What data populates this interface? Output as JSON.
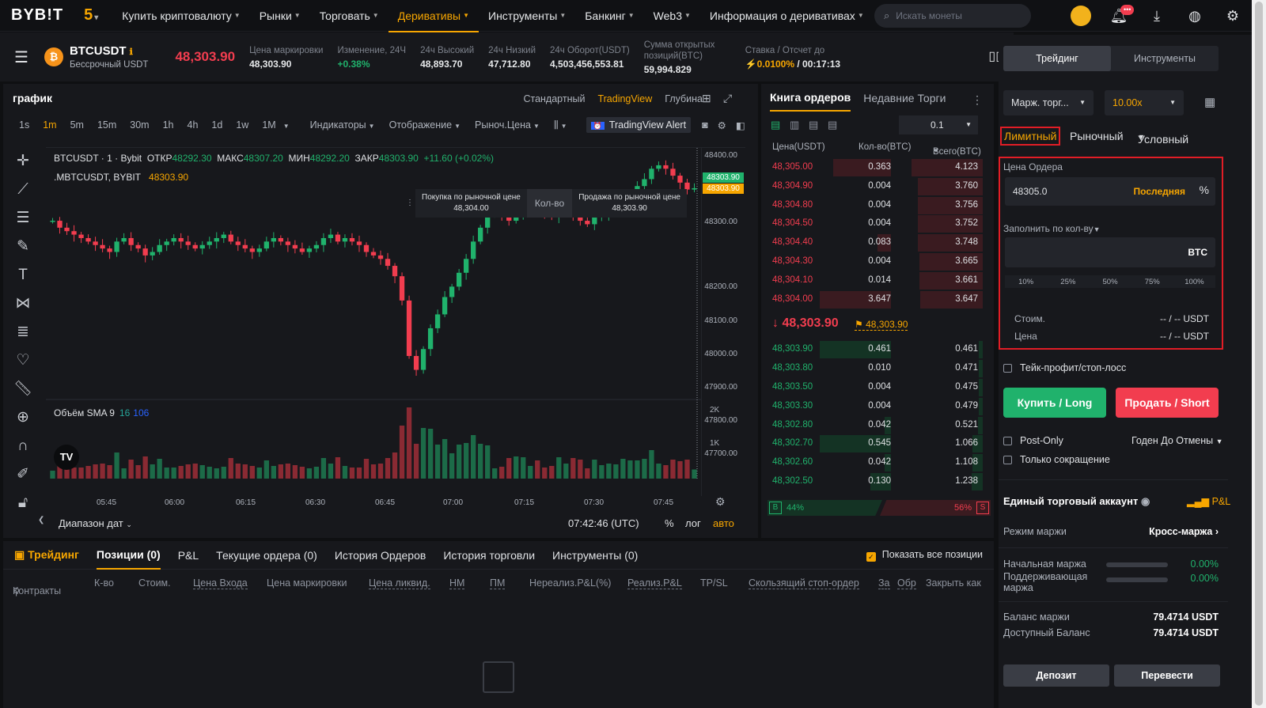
{
  "nav": {
    "logo": "BYB!T",
    "five": "5",
    "items": [
      {
        "label": "Купить криптовалюту"
      },
      {
        "label": "Рынки"
      },
      {
        "label": "Торговать"
      },
      {
        "label": "Деривативы"
      },
      {
        "label": "Инструменты"
      },
      {
        "label": "Банкинг"
      },
      {
        "label": "Web3"
      },
      {
        "label": "Информация о деривативах"
      }
    ],
    "search_placeholder": "Искать монеты",
    "icons": [
      "avatar-icon",
      "bell-icon",
      "download-icon",
      "globe-icon",
      "settings-icon"
    ],
    "bell_badge": "•••"
  },
  "ticker": {
    "symbol": "BTCUSDT",
    "subtitle": "Бессрочный USDT",
    "last_price": "48,303.90",
    "stats": [
      {
        "label": "Цена маркировки",
        "value": "48,303.90"
      },
      {
        "label": "Изменение, 24Ч",
        "value": "+0.38%"
      },
      {
        "label": "24ч Высокий",
        "value": "48,893.70"
      },
      {
        "label": "24ч Низкий",
        "value": "47,712.80"
      },
      {
        "label": "24ч Оборот(USDT)",
        "value": "4,503,456,553.81"
      },
      {
        "label": "Сумма открытых позиций(BTC)",
        "value": "59,994.829"
      },
      {
        "label": "Ставка / Отсчет до",
        "value_rate": "0.0100%",
        "value_time": "/ 00:17:13"
      }
    ]
  },
  "chart": {
    "title": "график",
    "modes": [
      "Стандартный",
      "TradingView",
      "Глубина"
    ],
    "active_mode": "TradingView",
    "timeframes": [
      "1s",
      "1m",
      "5m",
      "15m",
      "30m",
      "1h",
      "4h",
      "1d",
      "1w",
      "1M"
    ],
    "active_tf": "1m",
    "menus": [
      "Индикаторы",
      "Отображение",
      "Рыноч.Цена"
    ],
    "tv_alert": "TradingView Alert",
    "legend": {
      "line1_prefix": "BTCUSDT · 1 · Bybit",
      "o_label": "ОТКР",
      "o": "48292.30",
      "h_label": "МАКС",
      "h": "48307.20",
      "l_label": "МИН",
      "l": "48292.20",
      "c_label": "ЗАКР",
      "c": "48303.90",
      "chg": "+11.60 (+0.02%)",
      "line2": ".MBTCUSDT, BYBIT",
      "line2_value": "48303.90"
    },
    "quick": {
      "buy_label": "Покупка по рыночной цене",
      "buy_price": "48,304.00",
      "qty": "Кол-во",
      "sell_label": "Продажа по рыночной цене",
      "sell_price": "48,303.90"
    },
    "volume_label": "Объём SMA 9",
    "volume_v1": "16",
    "volume_v2": "106",
    "price_tag1": "48303.90",
    "price_tag2": "48303.90",
    "footer": {
      "date_range": "Диапазон дат",
      "time": "07:42:46 (UTC)",
      "pct": "%",
      "log": "лог",
      "auto": "авто"
    }
  },
  "chart_data": {
    "type": "candlestick",
    "y_ticks": [
      "48400.00",
      "48300.00",
      "48200.00",
      "48100.00",
      "48000.00",
      "47900.00",
      "47800.00",
      "47700.00"
    ],
    "volume_ticks": [
      "2K",
      "1K"
    ],
    "x_ticks": [
      "05:45",
      "06:00",
      "06:15",
      "06:30",
      "06:45",
      "07:00",
      "07:15",
      "07:30",
      "07:45"
    ],
    "price_range": [
      47690,
      48420
    ],
    "close_series": [
      48210,
      48190,
      48180,
      48170,
      48160,
      48150,
      48140,
      48130,
      48120,
      48150,
      48160,
      48140,
      48130,
      48110,
      48120,
      48140,
      48150,
      48160,
      48150,
      48140,
      48130,
      48140,
      48150,
      48160,
      48170,
      48150,
      48140,
      48130,
      48120,
      48130,
      48150,
      48160,
      48150,
      48140,
      48130,
      48120,
      48130,
      48140,
      48160,
      48170,
      48150,
      48160,
      48150,
      48140,
      48120,
      48110,
      48100,
      48080,
      48050,
      47980,
      47820,
      47780,
      47840,
      47900,
      47940,
      47990,
      48020,
      48060,
      48100,
      48150,
      48190,
      48230,
      48240,
      48230,
      48210,
      48230,
      48250,
      48260,
      48240,
      48230,
      48220,
      48240,
      48250,
      48230,
      48210,
      48200,
      48220,
      48230,
      48240,
      48250,
      48270,
      48290,
      48310,
      48330,
      48360,
      48370,
      48360,
      48340,
      48320,
      48300,
      48303.9
    ]
  },
  "orderbook": {
    "tab_active": "Книга ордеров",
    "tab_other": "Недавние Торги",
    "precision": "0.1",
    "cols": [
      "Цена(USDT)",
      "Кол-во(BTC)",
      "Всего(BTC)"
    ],
    "asks": [
      {
        "p": "48,305.00",
        "q": "0.363",
        "t": "4.123",
        "w": 100
      },
      {
        "p": "48,304.90",
        "q": "0.004",
        "t": "3.760",
        "w": 91
      },
      {
        "p": "48,304.80",
        "q": "0.004",
        "t": "3.756",
        "w": 91
      },
      {
        "p": "48,304.50",
        "q": "0.004",
        "t": "3.752",
        "w": 91
      },
      {
        "p": "48,304.40",
        "q": "0.083",
        "t": "3.748",
        "w": 91
      },
      {
        "p": "48,304.30",
        "q": "0.004",
        "t": "3.665",
        "w": 89
      },
      {
        "p": "48,304.10",
        "q": "0.014",
        "t": "3.661",
        "w": 89
      },
      {
        "p": "48,304.00",
        "q": "3.647",
        "t": "3.647",
        "w": 88
      }
    ],
    "mid_price": "48,303.90",
    "mid_mark": "48,303.90",
    "bids": [
      {
        "p": "48,303.90",
        "q": "0.461",
        "t": "0.461",
        "w": 6
      },
      {
        "p": "48,303.80",
        "q": "0.010",
        "t": "0.471",
        "w": 6
      },
      {
        "p": "48,303.50",
        "q": "0.004",
        "t": "0.475",
        "w": 6
      },
      {
        "p": "48,303.30",
        "q": "0.004",
        "t": "0.479",
        "w": 6
      },
      {
        "p": "48,302.80",
        "q": "0.042",
        "t": "0.521",
        "w": 7
      },
      {
        "p": "48,302.70",
        "q": "0.545",
        "t": "1.066",
        "w": 14
      },
      {
        "p": "48,302.60",
        "q": "0.042",
        "t": "1.108",
        "w": 14
      },
      {
        "p": "48,302.50",
        "q": "0.130",
        "t": "1.238",
        "w": 16
      }
    ],
    "buy_ratio": "44%",
    "sell_ratio": "56%",
    "b": "B",
    "s": "S"
  },
  "bottom": {
    "tabs": [
      "Трейдинг",
      "Позиции (0)",
      "P&L",
      "Текущие ордера (0)",
      "История Ордеров",
      "История торговли",
      "Инструменты (0)"
    ],
    "show_all": "Показать все позиции",
    "cols": [
      "Контракты",
      "К-во",
      "Стоим.",
      "Цена Входа",
      "Цена маркировки",
      "Цена ликвид.",
      "НМ",
      "ПМ",
      "Нереализ.P&L(%)",
      "Реализ.P&L",
      "TP/SL",
      "Скользящий стоп-ордер",
      "За",
      "Обр",
      "Закрыть как"
    ]
  },
  "order": {
    "tabs": [
      "Трейдинг",
      "Инструменты"
    ],
    "margin_mode": "Марж. торг...",
    "leverage": "10.00x",
    "types": [
      "Лимитный",
      "Рыночный",
      "Условный"
    ],
    "price_label": "Цена Ордера",
    "price_value": "48305.0",
    "last_btn": "Последняя",
    "fill_label": "Заполнить по кол-ву",
    "qty_unit": "BTC",
    "pcts": [
      "10%",
      "25%",
      "50%",
      "75%",
      "100%"
    ],
    "cost_label": "Стоим.",
    "price2_label": "Цена",
    "cost_value": "-- / -- USDT",
    "tpsl": "Тейк-профит/стоп-лосс",
    "buy": "Купить / Long",
    "sell": "Продать / Short",
    "post_only": "Post-Only",
    "tif": "Годен До Отмены",
    "reduce_only": "Только сокращение",
    "uta_title": "Единый торговый аккаунт",
    "pnl_link": "P&L",
    "margin_mode_label": "Режим маржи",
    "margin_mode_value": "Кросс-маржа",
    "im_label": "Начальная маржа",
    "im_value": "0.00%",
    "mm_label": "Поддерживающая маржа",
    "mm_value": "0.00%",
    "balance_label": "Баланс маржи",
    "balance_value": "79.4714 USDT",
    "avail_label": "Доступный Баланс",
    "avail_value": "79.4714 USDT",
    "deposit": "Депозит",
    "transfer": "Перевести"
  },
  "colors": {
    "accent": "#f7a600",
    "up": "#20b26c",
    "down": "#f23d4f",
    "highlight": "#e11d26"
  }
}
